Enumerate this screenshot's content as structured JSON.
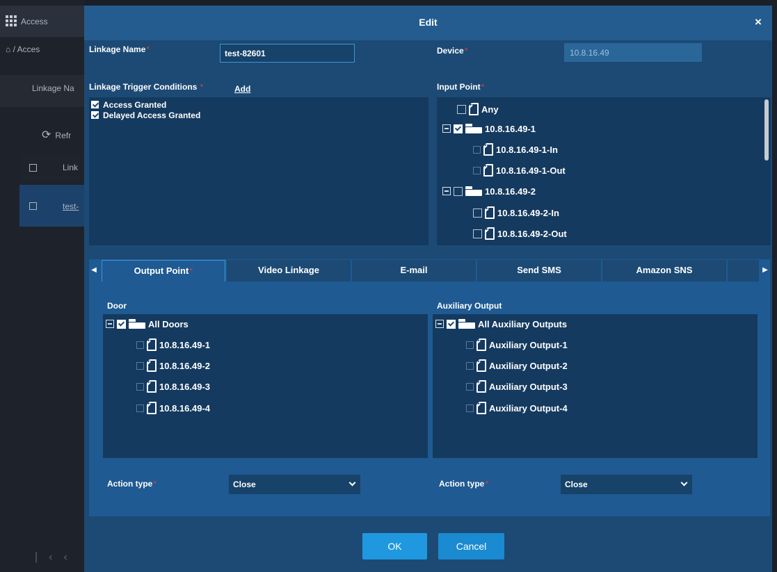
{
  "background": {
    "app_title": "Access",
    "breadcrumb": "/ Acces",
    "filter_label": "Linkage Na",
    "refresh_label": "Refr",
    "column_header": "Link",
    "row_name": "test-"
  },
  "dialog": {
    "title": "Edit",
    "close_glyph": "×",
    "linkage_name_label": "Linkage Name",
    "linkage_name_value": "test-82601",
    "device_label": "Device",
    "device_value": "10.8.16.49",
    "trigger_label": "Linkage Trigger Conditions",
    "add_label": "Add",
    "triggers": [
      {
        "label": "Access Granted",
        "checked": true
      },
      {
        "label": "Delayed Access Granted",
        "checked": true
      }
    ],
    "input_point_label": "Input Point",
    "input_tree": [
      {
        "label": "Any"
      },
      {
        "label": "10.8.16.49-1"
      },
      {
        "label": "10.8.16.49-1-In"
      },
      {
        "label": "10.8.16.49-1-Out"
      },
      {
        "label": "10.8.16.49-2"
      },
      {
        "label": "10.8.16.49-2-In"
      },
      {
        "label": "10.8.16.49-2-Out"
      }
    ],
    "tabs": [
      "Output Point",
      "Video Linkage",
      "E-mail",
      "Send SMS",
      "Amazon SNS"
    ],
    "active_tab": "Output Point",
    "door": {
      "label": "Door",
      "root": "All Doors",
      "items": [
        "10.8.16.49-1",
        "10.8.16.49-2",
        "10.8.16.49-3",
        "10.8.16.49-4"
      ],
      "action_label": "Action type",
      "action_value": "Close"
    },
    "aux": {
      "label": "Auxiliary Output",
      "root": "All Auxiliary Outputs",
      "items": [
        "Auxiliary Output-1",
        "Auxiliary Output-2",
        "Auxiliary Output-3",
        "Auxiliary Output-4"
      ],
      "action_label": "Action type",
      "action_value": "Close"
    },
    "ok_label": "OK",
    "cancel_label": "Cancel"
  },
  "colors": {
    "dialog_bg": "#1c4a75",
    "title_bar": "#255c8f",
    "panel_bg": "#1f5a92",
    "list_bg": "#153a5f",
    "accent": "#1f98e0",
    "required": "#e23b3b"
  }
}
